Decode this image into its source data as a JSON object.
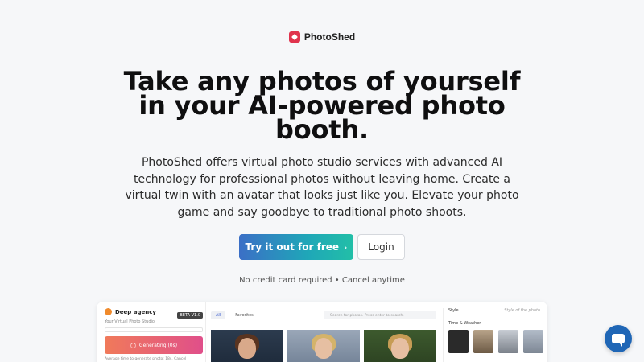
{
  "brand": {
    "name": "PhotoShed",
    "logo_color": "#e0334d"
  },
  "hero": {
    "headline": "Take any photos of yourself in your AI-powered photo booth.",
    "description": "PhotoShed offers virtual photo studio services with advanced AI technology for professional photos without leaving home. Create a virtual twin with an avatar that looks just like you. Elevate your photo game and say goodbye to traditional photo shoots."
  },
  "cta": {
    "primary_label": "Try it out for free",
    "primary_icon": "chevron-right-icon",
    "secondary_label": "Login",
    "note": "No credit card required • Cancel anytime"
  },
  "preview": {
    "app_name": "Deep agency",
    "beta_badge": "BETA V1.0",
    "subtitle": "Your Virtual Photo Studio",
    "generate_label": "Generating (0s)",
    "tip": "Average time to generate photo: 18s. Cancel",
    "tabs": [
      "All",
      "Favorites"
    ],
    "search_placeholder": "Search for photos. Press enter to search.",
    "style_label": "Style",
    "style_hint": "Style of the photo",
    "time_weather_label": "Time & Weather"
  },
  "chat": {
    "icon": "chat-icon",
    "color": "#1f66b6"
  }
}
